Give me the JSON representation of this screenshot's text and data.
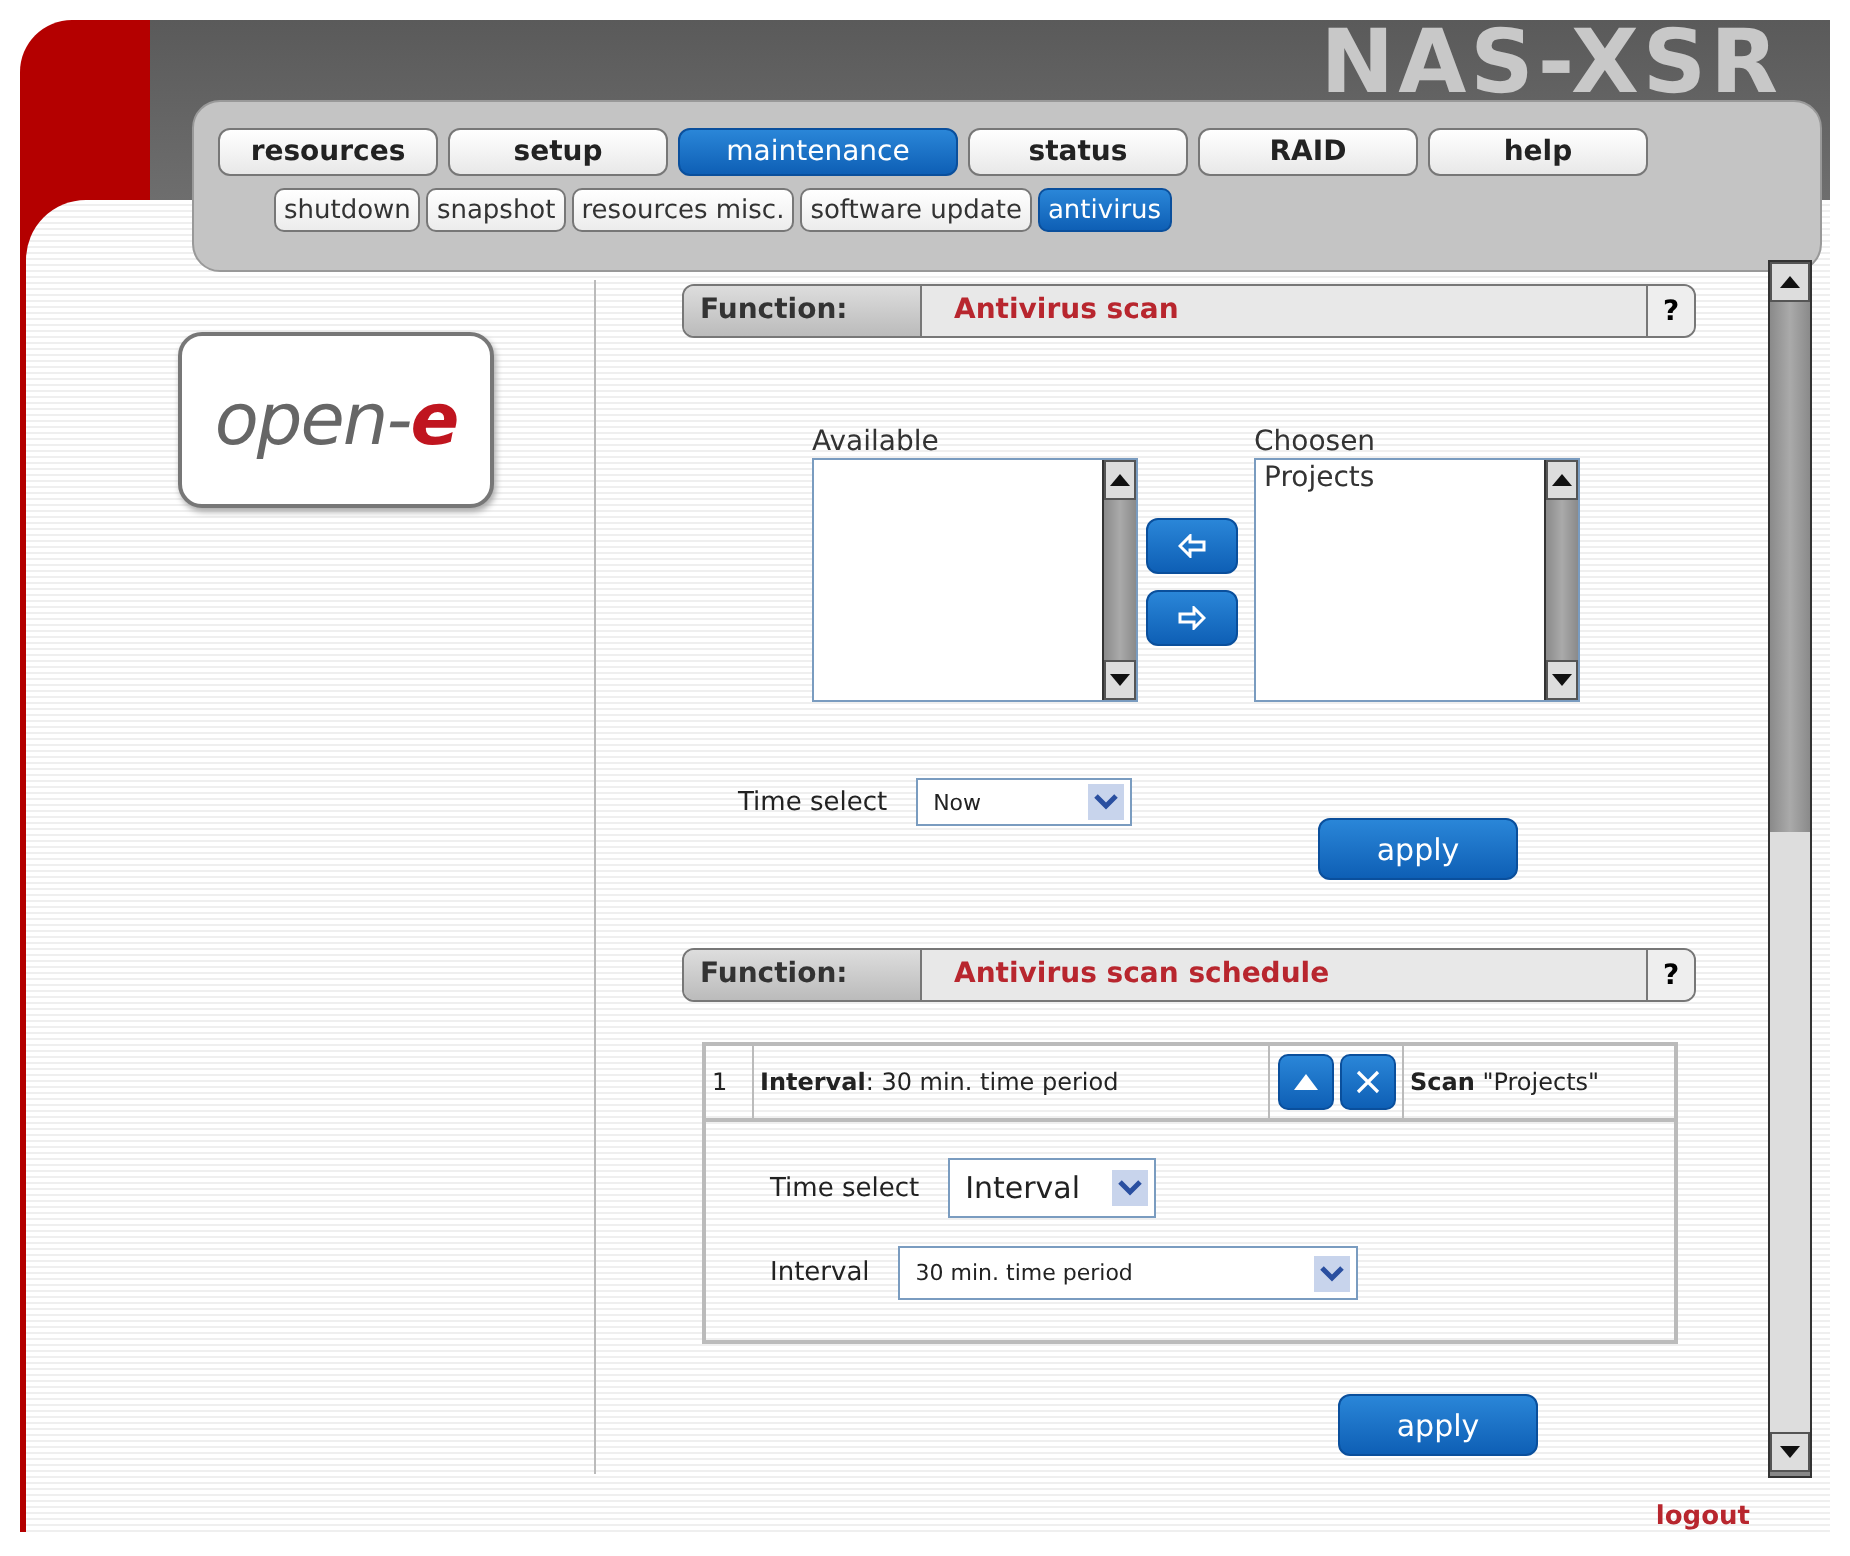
{
  "title": "NAS-XSR",
  "tabs": [
    {
      "label": "resources",
      "selected": false
    },
    {
      "label": "setup",
      "selected": false
    },
    {
      "label": "maintenance",
      "selected": true
    },
    {
      "label": "status",
      "selected": false
    },
    {
      "label": "RAID",
      "selected": false
    },
    {
      "label": "help",
      "selected": false
    }
  ],
  "subtabs": [
    {
      "label": "shutdown",
      "selected": false
    },
    {
      "label": "snapshot",
      "selected": false
    },
    {
      "label": "resources misc.",
      "selected": false
    },
    {
      "label": "software update",
      "selected": false
    },
    {
      "label": "antivirus",
      "selected": true
    }
  ],
  "logo": {
    "text": "open-",
    "accent": "e"
  },
  "scan": {
    "function_label": "Function:",
    "title": "Antivirus scan",
    "help": "?",
    "available": {
      "label": "Available"
    },
    "chosen": {
      "label": "Choosen",
      "items": [
        "Projects"
      ]
    },
    "time_select": {
      "label": "Time select",
      "value": "Now"
    },
    "apply": "apply"
  },
  "schedule": {
    "function_label": "Function:",
    "title": "Antivirus scan schedule",
    "help": "?",
    "entries": [
      {
        "index": "1",
        "summary": "**Interval**: 30 min. time period",
        "action": "**Scan** \"Projects\"",
        "time_select": {
          "label": "Time select",
          "value": "Interval"
        },
        "interval": {
          "label": "Interval",
          "value": "30 min. time period"
        }
      }
    ],
    "apply": "apply"
  },
  "logout": "logout"
}
